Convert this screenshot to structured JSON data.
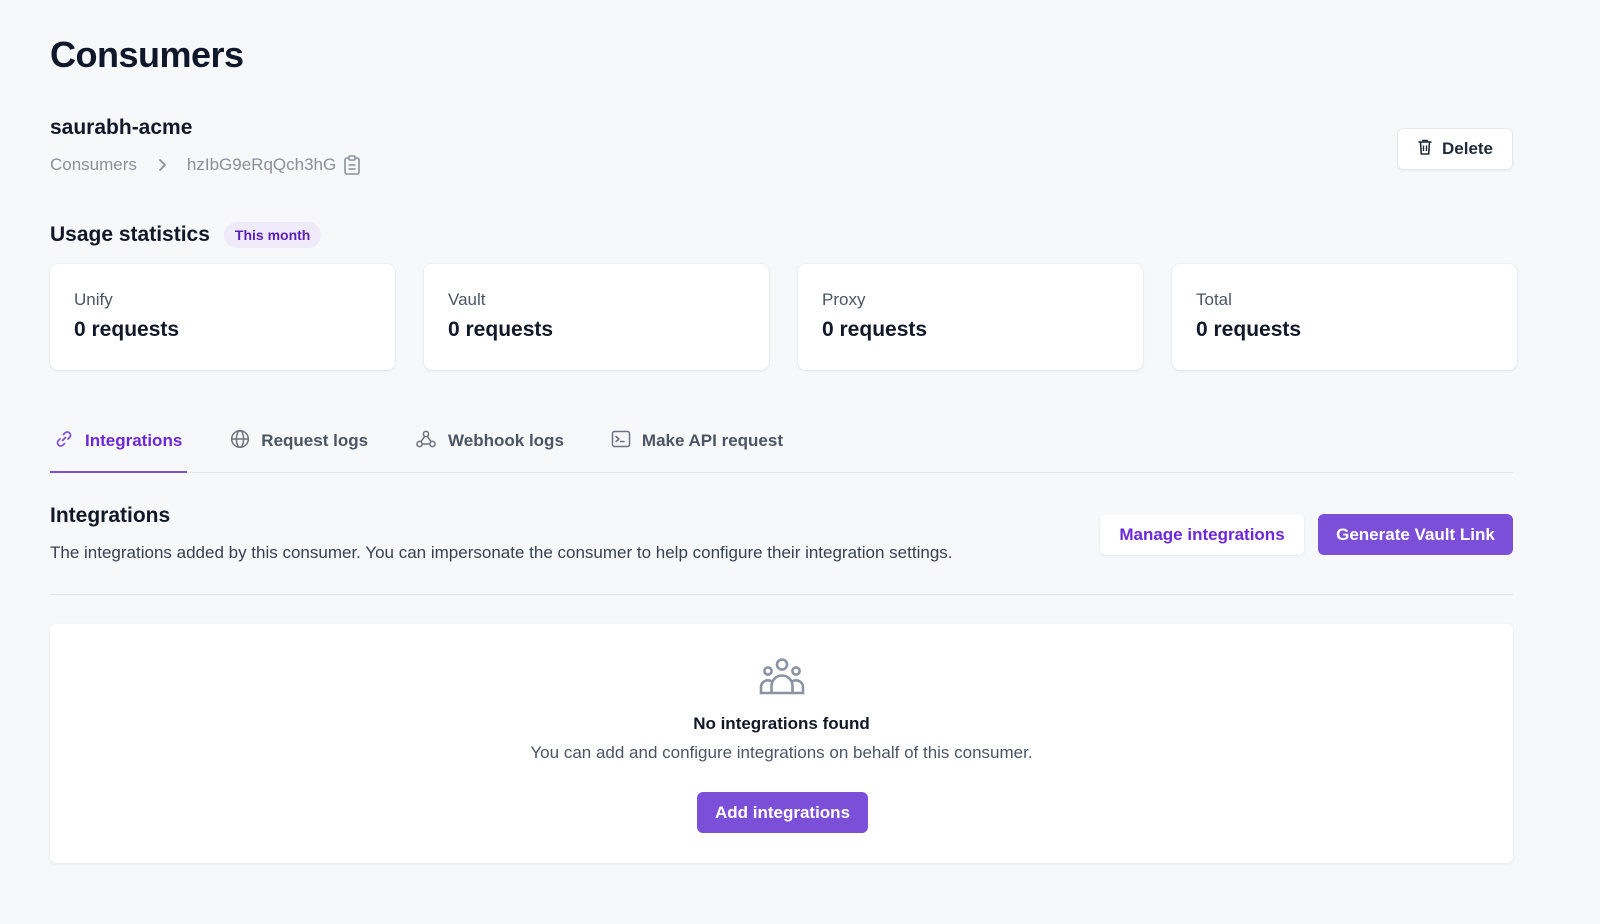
{
  "page": {
    "title": "Consumers"
  },
  "consumer": {
    "name": "saurabh-acme"
  },
  "breadcrumb": {
    "parent": "Consumers",
    "current": "hzIbG9eRqQch3hG"
  },
  "actions": {
    "delete_label": "Delete"
  },
  "usage": {
    "title": "Usage statistics",
    "period_badge": "This month",
    "cards": [
      {
        "label": "Unify",
        "value": "0 requests"
      },
      {
        "label": "Vault",
        "value": "0 requests"
      },
      {
        "label": "Proxy",
        "value": "0 requests"
      },
      {
        "label": "Total",
        "value": "0 requests"
      }
    ]
  },
  "tabs": [
    {
      "label": "Integrations",
      "icon": "link-icon",
      "active": true
    },
    {
      "label": "Request logs",
      "icon": "globe-icon",
      "active": false
    },
    {
      "label": "Webhook logs",
      "icon": "webhook-icon",
      "active": false
    },
    {
      "label": "Make API request",
      "icon": "terminal-icon",
      "active": false
    }
  ],
  "integrations": {
    "title": "Integrations",
    "description": "The integrations added by this consumer. You can impersonate the consumer to help configure their integration settings.",
    "manage_label": "Manage integrations",
    "vault_link_label": "Generate Vault Link",
    "empty": {
      "icon": "user-group-icon",
      "title": "No integrations found",
      "description": "You can add and configure integrations on behalf of this consumer.",
      "add_label": "Add integrations"
    }
  },
  "colors": {
    "accent": "#7b4fd8",
    "accent_text": "#6d28d9",
    "badge_bg": "#efeaf9",
    "background": "#f7f8fa"
  }
}
